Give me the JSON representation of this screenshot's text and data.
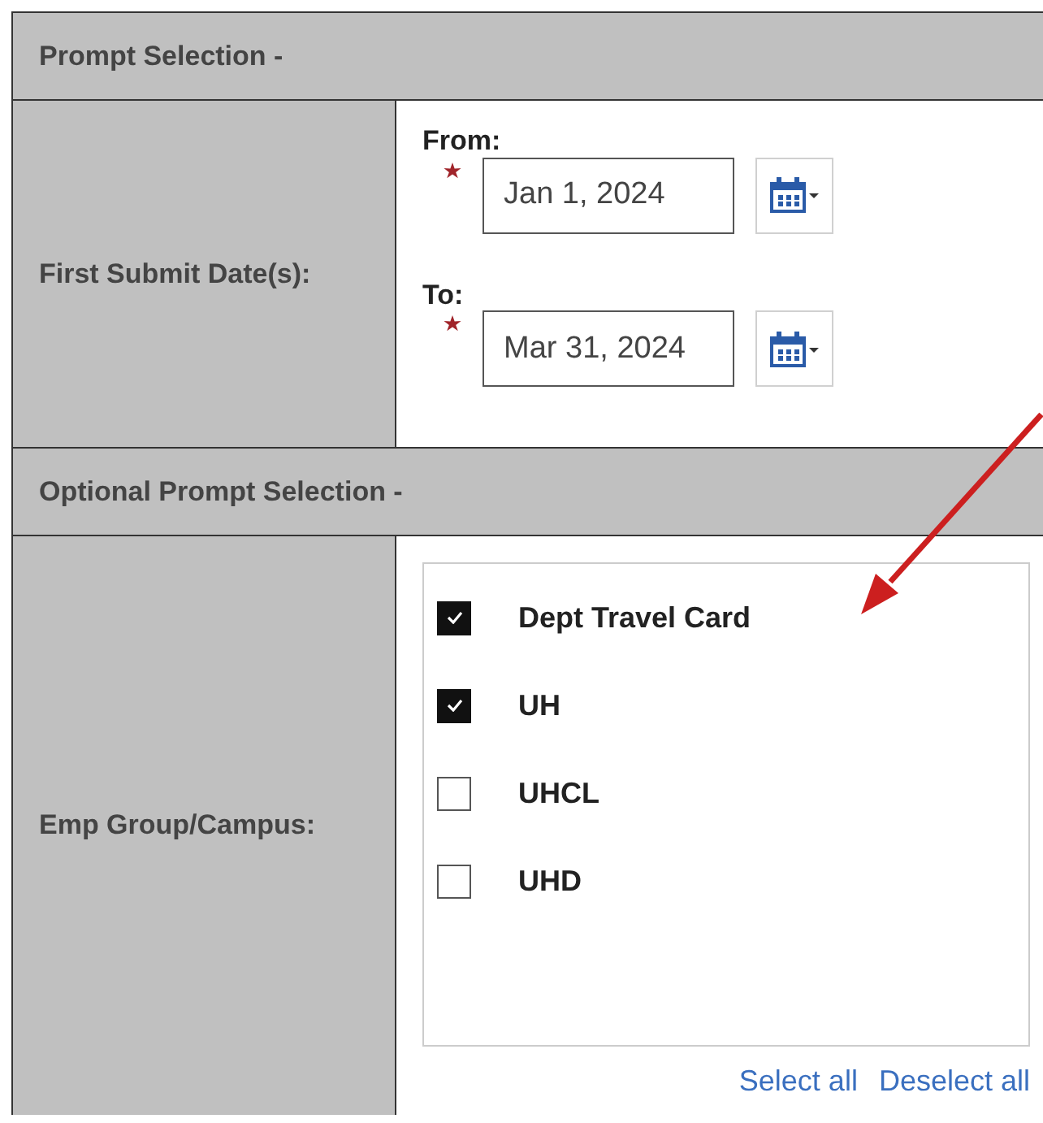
{
  "sections": [
    {
      "title": "Prompt Selection -",
      "rows": [
        {
          "label": "First Submit Date(s):",
          "kind": "date_range",
          "fields": [
            {
              "label": "From:",
              "required": true,
              "value": "Jan 1, 2024"
            },
            {
              "label": "To:",
              "required": true,
              "value": "Mar 31, 2024"
            }
          ]
        }
      ]
    },
    {
      "title": "Optional Prompt Selection -",
      "rows": [
        {
          "label": "Emp Group/Campus:",
          "kind": "checklist",
          "options": [
            {
              "label": "Dept Travel Card",
              "checked": true
            },
            {
              "label": "UH",
              "checked": true
            },
            {
              "label": "UHCL",
              "checked": false
            },
            {
              "label": "UHD",
              "checked": false
            }
          ],
          "links": [
            "Select all",
            "Deselect all"
          ]
        }
      ]
    }
  ],
  "annotation": {
    "kind": "arrow",
    "color": "#cc1f1f"
  }
}
